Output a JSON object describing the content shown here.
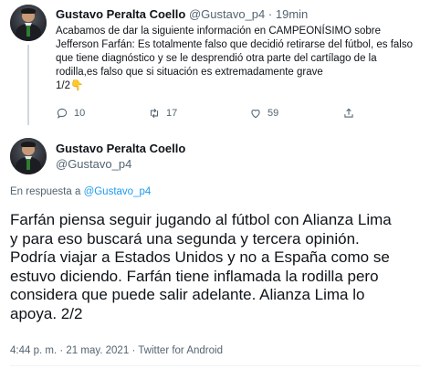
{
  "tweet1": {
    "author_name": "Gustavo Peralta Coello",
    "author_handle": "@Gustavo_p4",
    "separator": "·",
    "time_ago": "19min",
    "text_lines": [
      "Acabamos de dar la siguiente información en CAMPEONÍSIMO sobre",
      "Jefferson Farfán: Es totalmente falso que decidió retirarse del fútbol, es falso",
      "que  tiene diagnóstico y se le desprendió otra parte del cartílago de la",
      "rodilla,es falso que si situación es extremadamente grave",
      "1/2👇"
    ],
    "reply_count": "10",
    "retweet_count": "17",
    "like_count": "59"
  },
  "tweet2": {
    "author_name": "Gustavo Peralta Coello",
    "author_handle": "@Gustavo_p4",
    "reply_prefix": "En respuesta a ",
    "reply_handle": "@Gustavo_p4",
    "text_lines": [
      "Farfán piensa seguir jugando al fútbol con Alianza Lima",
      "y para eso buscará una segunda y tercera opinión.",
      "Podría viajar a Estados Unidos y no a España como se",
      "estuvo diciendo. Farfán tiene inflamada la rodilla pero",
      "considera que puede salir adelante. Alianza Lima lo",
      "apoya. 2/2"
    ],
    "time": "4:44 p. m.",
    "dot1": "·",
    "date": "21 may. 2021",
    "dot2": "·",
    "source": "Twitter for Android"
  },
  "icons": {
    "reply": "reply-icon",
    "retweet": "retweet-icon",
    "like": "heart-icon",
    "share": "share-icon"
  },
  "colors": {
    "link": "#1d9bf0",
    "muted": "#536471",
    "text": "#0f1419"
  }
}
